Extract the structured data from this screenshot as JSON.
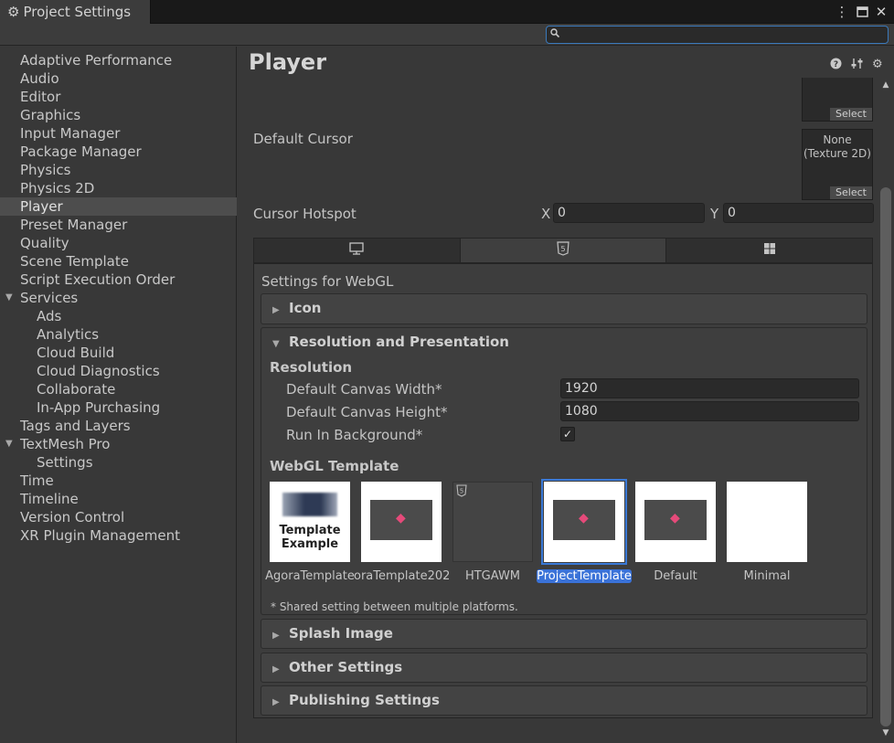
{
  "window": {
    "title": "Project Settings"
  },
  "search": {
    "placeholder": "",
    "value": ""
  },
  "sidebar": {
    "items": [
      {
        "label": "Adaptive Performance"
      },
      {
        "label": "Audio"
      },
      {
        "label": "Editor"
      },
      {
        "label": "Graphics"
      },
      {
        "label": "Input Manager"
      },
      {
        "label": "Package Manager"
      },
      {
        "label": "Physics"
      },
      {
        "label": "Physics 2D"
      },
      {
        "label": "Player",
        "selected": true
      },
      {
        "label": "Preset Manager"
      },
      {
        "label": "Quality"
      },
      {
        "label": "Scene Template"
      },
      {
        "label": "Script Execution Order"
      },
      {
        "label": "Services",
        "expandable": true
      },
      {
        "label": "Ads",
        "child": true
      },
      {
        "label": "Analytics",
        "child": true
      },
      {
        "label": "Cloud Build",
        "child": true
      },
      {
        "label": "Cloud Diagnostics",
        "child": true
      },
      {
        "label": "Collaborate",
        "child": true
      },
      {
        "label": "In-App Purchasing",
        "child": true
      },
      {
        "label": "Tags and Layers"
      },
      {
        "label": "TextMesh Pro",
        "expandable": true
      },
      {
        "label": "Settings",
        "child": true
      },
      {
        "label": "Time"
      },
      {
        "label": "Timeline"
      },
      {
        "label": "Version Control"
      },
      {
        "label": "XR Plugin Management"
      }
    ]
  },
  "main": {
    "title": "Player",
    "default_cursor": {
      "label": "Default Cursor",
      "none_text_1": "None",
      "none_text_2": "(Texture 2D)",
      "select_label": "Select"
    },
    "cursor_hotspot": {
      "label": "Cursor Hotspot",
      "x_label": "X",
      "x_value": "0",
      "y_label": "Y",
      "y_value": "0"
    },
    "platform_tabs": [
      {
        "name": "standalone",
        "icon": "monitor-icon"
      },
      {
        "name": "webgl",
        "icon": "html5-icon",
        "active": true
      },
      {
        "name": "windows",
        "icon": "windows-icon"
      }
    ],
    "settings_for": "Settings for WebGL",
    "sections": {
      "icon": "Icon",
      "resolution": "Resolution and Presentation",
      "splash": "Splash Image",
      "other": "Other Settings",
      "publishing": "Publishing Settings"
    },
    "resolution": {
      "subheading": "Resolution",
      "canvas_width_label": "Default Canvas Width*",
      "canvas_width_value": "1920",
      "canvas_height_label": "Default Canvas Height*",
      "canvas_height_value": "1080",
      "run_in_background_label": "Run In Background*",
      "run_in_background_checked": true
    },
    "webgl_template": {
      "heading": "WebGL Template",
      "thumb_text_line1": "Template",
      "thumb_text_line2": "Example",
      "templates": [
        {
          "name": "AgoraTemplate"
        },
        {
          "name": "oraTemplate202"
        },
        {
          "name": "HTGAWM"
        },
        {
          "name": "ProjectTemplate",
          "selected": true
        },
        {
          "name": "Default"
        },
        {
          "name": "Minimal"
        }
      ]
    },
    "shared_note": "* Shared setting between multiple platforms."
  },
  "colors": {
    "selection": "#3a72d8",
    "accent_pink": "#e64a7a",
    "background": "#383838"
  }
}
